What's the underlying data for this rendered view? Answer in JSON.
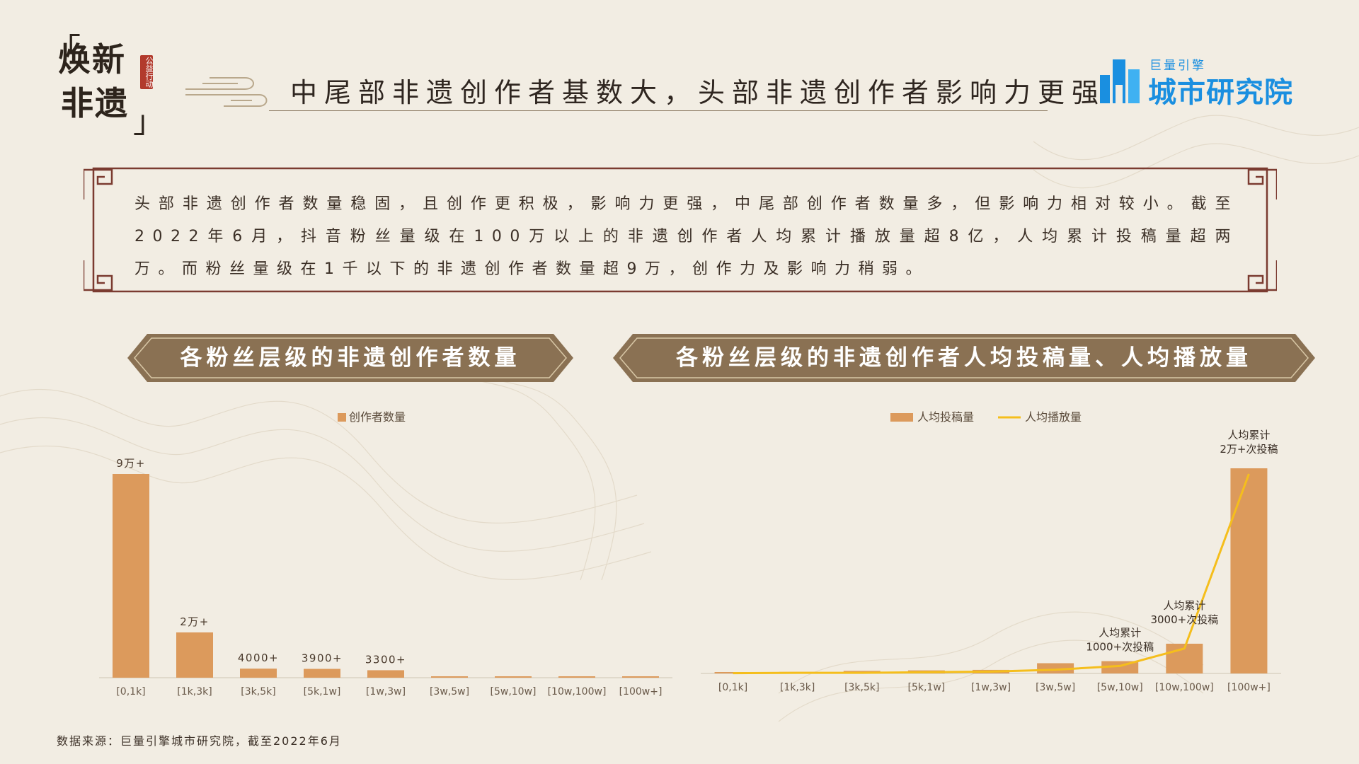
{
  "header": {
    "logo_line1": "焕新",
    "logo_line2": "非遗",
    "logo_seal": "公益行动",
    "title": "中尾部非遗创作者基数大，头部非遗创作者影响力更强",
    "brand_top": "巨量引擎",
    "brand_main": "城市研究院"
  },
  "description": "头部非遗创作者数量稳固，且创作更积极，影响力更强，中尾部创作者数量多，但影响力相对较小。截至2022年6月，抖音粉丝量级在100万以上的非遗创作者人均累计播放量超8亿，人均累计投稿量超两万。而粉丝量级在1千以下的非遗创作者数量超9万，创作力及影响力稍弱。",
  "sections": {
    "left_title": "各粉丝层级的非遗创作者数量",
    "right_title": "各粉丝层级的非遗创作者人均投稿量、人均播放量"
  },
  "source": "数据来源：巨量引擎城市研究院，截至2022年6月",
  "colors": {
    "bar": "#dc9a5c",
    "line": "#f5be1c",
    "banner": "#8a7153",
    "border": "#7b3b30",
    "brand": "#1a8fe0"
  },
  "chart_data": [
    {
      "type": "bar",
      "legend": [
        "创作者数量"
      ],
      "legend_position": "top-center",
      "categories": [
        "[0,1k]",
        "[1k,3k]",
        "[3k,5k]",
        "[5k,1w]",
        "[1w,3w]",
        "[3w,5w]",
        "[5w,10w]",
        "[10w,100w]",
        "[100w+]"
      ],
      "series": [
        {
          "name": "创作者数量",
          "values": [
            90000,
            20000,
            4000,
            3900,
            3300,
            600,
            500,
            500,
            200
          ]
        }
      ],
      "data_labels": [
        "9万+",
        "2万+",
        "4000+",
        "3900+",
        "3300+",
        "",
        "",
        "",
        ""
      ],
      "ylim": [
        0,
        90000
      ],
      "grid": false
    },
    {
      "type": "bar",
      "legend": [
        "人均投稿量",
        "人均播放量"
      ],
      "legend_position": "top-center",
      "categories": [
        "[0,1k]",
        "[1k,3k]",
        "[3k,5k]",
        "[5k,1w]",
        "[1w,3w]",
        "[3w,5w]",
        "[5w,10w]",
        "[10w,100w]",
        "[100w+]"
      ],
      "series": [
        {
          "name": "人均投稿量",
          "type": "bar",
          "values": [
            50,
            150,
            250,
            300,
            350,
            1000,
            1200,
            2900,
            20000
          ]
        },
        {
          "name": "人均播放量",
          "type": "line",
          "values": [
            0.2,
            0.5,
            0.5,
            1,
            1.5,
            3,
            6,
            20,
            160
          ]
        }
      ],
      "annotations": [
        {
          "category": "[10w,100w]",
          "lines": [
            "人均累计",
            "1000+次投稿"
          ],
          "target": "[5w,10w]"
        },
        {
          "category": "[10w,100w]",
          "lines": [
            "人均累计",
            "3000+次投稿"
          ],
          "target": "[10w,100w]"
        },
        {
          "category": "[100w+]",
          "lines": [
            "人均累计",
            "2万+次投稿"
          ],
          "target": "[100w+]"
        }
      ],
      "ylim": [
        0,
        20000
      ],
      "grid": false
    }
  ]
}
